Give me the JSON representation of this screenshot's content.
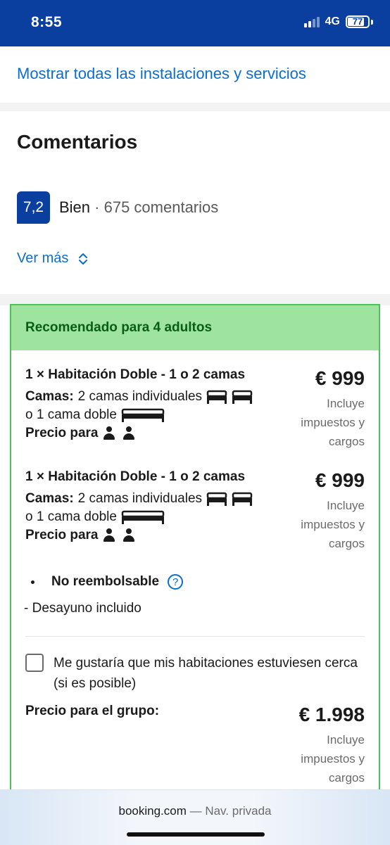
{
  "status_bar": {
    "time": "8:55",
    "network": "4G",
    "battery": "77"
  },
  "links": {
    "all_services": "Mostrar todas las instalaciones y servicios"
  },
  "reviews": {
    "title": "Comentarios",
    "score": "7,2",
    "label": "Bien",
    "separator": " · ",
    "count": "675 comentarios",
    "more": "Ver más"
  },
  "recommendation": {
    "header": "Recomendado para 4 adultos",
    "rooms": [
      {
        "title": "1 × Habitación Doble - 1 o 2 camas",
        "beds_label": "Camas:",
        "beds_single": "2 camas individuales",
        "beds_double": "o 1 cama doble",
        "price_for": "Precio para",
        "price": "€ 999",
        "tax_lines": [
          "Incluye",
          "impuestos y",
          "cargos"
        ]
      },
      {
        "title": "1 × Habitación Doble - 1 o 2 camas",
        "beds_label": "Camas:",
        "beds_single": "2 camas individuales",
        "beds_double": "o 1 cama doble",
        "price_for": "Precio para",
        "price": "€ 999",
        "tax_lines": [
          "Incluye",
          "impuestos y",
          "cargos"
        ]
      }
    ],
    "policy": "No reembolsable",
    "policy_help": "?",
    "breakfast": "- Desayuno incluido",
    "nearby_checkbox": "Me gustaría que mis habitaciones estuviesen cerca (si es posible)",
    "group_price_label": "Precio para el grupo:",
    "group_price": "€ 1.998",
    "group_tax_lines": [
      "Incluye",
      "impuestos y",
      "cargos"
    ]
  },
  "browser": {
    "domain": "booking.com",
    "mode": " — Nav. privada"
  },
  "colors": {
    "brand_blue": "#0a3fa0",
    "link_blue": "#0a6ed1",
    "recommend_green": "#9ee39e",
    "recommend_border": "#4cc25a"
  }
}
